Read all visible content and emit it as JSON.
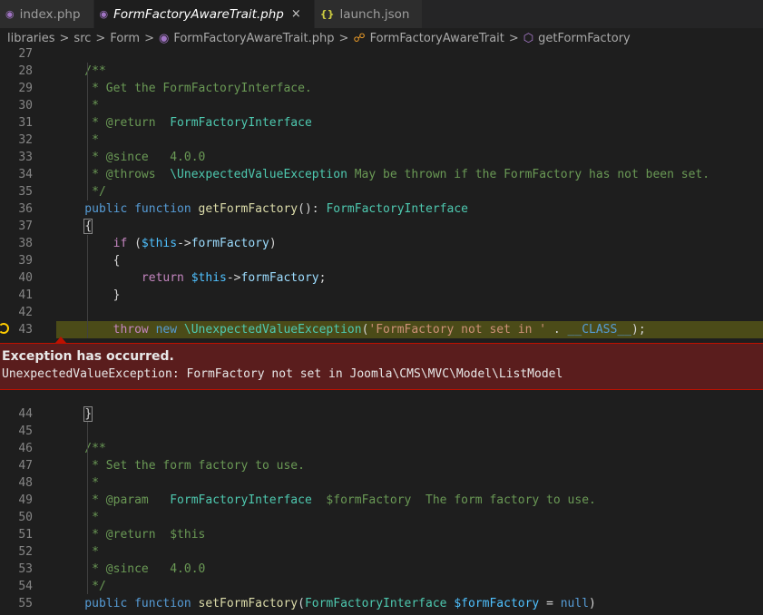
{
  "tabs": [
    {
      "label": "index.php",
      "icon": "php-elephant-icon"
    },
    {
      "label": "FormFactoryAwareTrait.php",
      "icon": "php-elephant-icon",
      "close": "×"
    },
    {
      "label": "launch.json",
      "icon": "json-braces-icon",
      "icon_glyph": "{}"
    }
  ],
  "breadcrumb": {
    "separator": ">",
    "items": [
      "libraries",
      "src",
      "Form",
      "FormFactoryAwareTrait.php",
      "FormFactoryAwareTrait",
      "getFormFactory"
    ]
  },
  "exception": {
    "title": "Exception has occurred.",
    "message": "UnexpectedValueException: FormFactory not set in Joomla\\CMS\\MVC\\Model\\ListModel"
  },
  "lines_top": [
    {
      "n": "27",
      "tokens": []
    },
    {
      "n": "28",
      "tokens": [
        [
          "c",
          "    /**"
        ]
      ]
    },
    {
      "n": "29",
      "tokens": [
        [
          "c",
          "     * Get the FormFactoryInterface."
        ]
      ]
    },
    {
      "n": "30",
      "tokens": [
        [
          "c",
          "     *"
        ]
      ]
    },
    {
      "n": "31",
      "tokens": [
        [
          "c",
          "     * @return  "
        ],
        [
          "t",
          "FormFactoryInterface"
        ]
      ]
    },
    {
      "n": "32",
      "tokens": [
        [
          "c",
          "     *"
        ]
      ]
    },
    {
      "n": "33",
      "tokens": [
        [
          "c",
          "     * @since   4.0.0"
        ]
      ]
    },
    {
      "n": "34",
      "tokens": [
        [
          "c",
          "     * @throws  "
        ],
        [
          "t",
          "\\UnexpectedValueException"
        ],
        [
          "c",
          " May be thrown if the FormFactory has not been set."
        ]
      ]
    },
    {
      "n": "35",
      "tokens": [
        [
          "c",
          "     */"
        ]
      ]
    },
    {
      "n": "36",
      "tokens": [
        [
          "k",
          "    public function "
        ],
        [
          "f",
          "getFormFactory"
        ],
        [
          "p",
          "(): "
        ],
        [
          "t",
          "FormFactoryInterface"
        ]
      ]
    },
    {
      "n": "37",
      "tokens": [
        [
          "p",
          "    "
        ],
        [
          "bracket",
          "{"
        ]
      ]
    },
    {
      "n": "38",
      "tokens": [
        [
          "ctl",
          "        if "
        ],
        [
          "p",
          "("
        ],
        [
          "var",
          "$this"
        ],
        [
          "p",
          "->"
        ],
        [
          "v",
          "formFactory"
        ],
        [
          "p",
          ")"
        ]
      ]
    },
    {
      "n": "39",
      "tokens": [
        [
          "p",
          "        {"
        ]
      ]
    },
    {
      "n": "40",
      "tokens": [
        [
          "ctl",
          "            return "
        ],
        [
          "var",
          "$this"
        ],
        [
          "p",
          "->"
        ],
        [
          "v",
          "formFactory"
        ],
        [
          "p",
          ";"
        ]
      ]
    },
    {
      "n": "41",
      "tokens": [
        [
          "p",
          "        }"
        ]
      ]
    },
    {
      "n": "42",
      "tokens": []
    },
    {
      "n": "43",
      "tokens": [
        [
          "ctl",
          "        throw "
        ],
        [
          "k",
          "new "
        ],
        [
          "t",
          "\\UnexpectedValueException"
        ],
        [
          "p",
          "("
        ],
        [
          "s",
          "'FormFactory not set in '"
        ],
        [
          "p",
          " . "
        ],
        [
          "k",
          "__CLASS__"
        ],
        [
          "p",
          ");"
        ]
      ]
    }
  ],
  "lines_bottom": [
    {
      "n": "44",
      "tokens": [
        [
          "p",
          "    "
        ],
        [
          "bracket",
          "}"
        ]
      ]
    },
    {
      "n": "45",
      "tokens": []
    },
    {
      "n": "46",
      "tokens": [
        [
          "c",
          "    /**"
        ]
      ]
    },
    {
      "n": "47",
      "tokens": [
        [
          "c",
          "     * Set the form factory to use."
        ]
      ]
    },
    {
      "n": "48",
      "tokens": [
        [
          "c",
          "     *"
        ]
      ]
    },
    {
      "n": "49",
      "tokens": [
        [
          "c",
          "     * @param   "
        ],
        [
          "t",
          "FormFactoryInterface"
        ],
        [
          "c",
          "  $formFactory  The form factory to use."
        ]
      ]
    },
    {
      "n": "50",
      "tokens": [
        [
          "c",
          "     *"
        ]
      ]
    },
    {
      "n": "51",
      "tokens": [
        [
          "c",
          "     * @return  $this"
        ]
      ]
    },
    {
      "n": "52",
      "tokens": [
        [
          "c",
          "     *"
        ]
      ]
    },
    {
      "n": "53",
      "tokens": [
        [
          "c",
          "     * @since   4.0.0"
        ]
      ]
    },
    {
      "n": "54",
      "tokens": [
        [
          "c",
          "     */"
        ]
      ]
    },
    {
      "n": "55",
      "tokens": [
        [
          "k",
          "    public function "
        ],
        [
          "f",
          "setFormFactory"
        ],
        [
          "p",
          "("
        ],
        [
          "t",
          "FormFactoryInterface"
        ],
        [
          "p",
          " "
        ],
        [
          "var",
          "$formFactory"
        ],
        [
          "p",
          " = "
        ],
        [
          "k",
          "null"
        ],
        [
          "p",
          ")"
        ]
      ]
    }
  ],
  "highlighted_line": "43",
  "colors": {
    "error_border": "#be1100",
    "error_bg": "#5a1d1d",
    "highlight": "#4b4b18",
    "debug_marker": "#ffcc00"
  }
}
